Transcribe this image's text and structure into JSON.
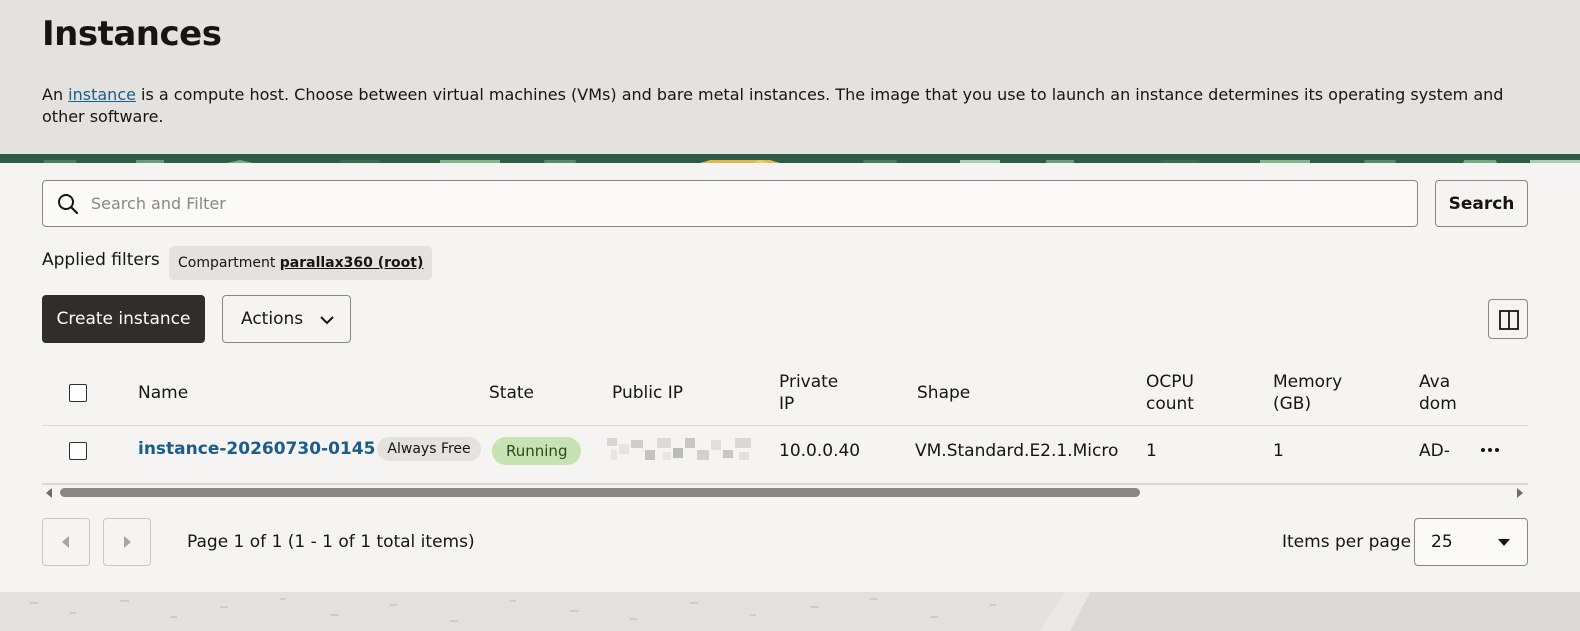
{
  "header": {
    "title": "Instances",
    "desc_before": "An ",
    "desc_link": "instance",
    "desc_after": " is a compute host. Choose between virtual machines (VMs) and bare metal instances. The image that you use to launch an instance determines its operating system and other software."
  },
  "search": {
    "placeholder": "Search and Filter",
    "button_label": "Search",
    "icon": "search-icon"
  },
  "filters": {
    "label": "Applied filters",
    "chip_key": "Compartment",
    "chip_value": "parallax360 (root)"
  },
  "toolbar": {
    "create_label": "Create instance",
    "actions_label": "Actions",
    "columns_icon": "columns-icon"
  },
  "table": {
    "headers": {
      "name": "Name",
      "state": "State",
      "public_ip": "Public IP",
      "private_ip_1": "Private",
      "private_ip_2": "IP",
      "shape": "Shape",
      "ocpu_1": "OCPU",
      "ocpu_2": "count",
      "memory_1": "Memory",
      "memory_2": "(GB)",
      "avail_1": "Ava",
      "avail_2": "dom"
    },
    "rows": [
      {
        "name": "instance-20260730-0145",
        "badge": "Always Free",
        "state": "Running",
        "private_ip": "10.0.0.40",
        "shape": "VM.Standard.E2.1.Micro",
        "ocpu": "1",
        "memory": "1",
        "availability": "AD-"
      }
    ]
  },
  "pagination": {
    "page_info": "Page 1 of 1 (1 - 1 of 1 total items)",
    "items_per_page_label": "Items per page",
    "items_per_page": "25"
  },
  "colors": {
    "primary_dark": "#312d2a",
    "link": "#1a5c8a",
    "running_badge": "#c8e3b3"
  }
}
